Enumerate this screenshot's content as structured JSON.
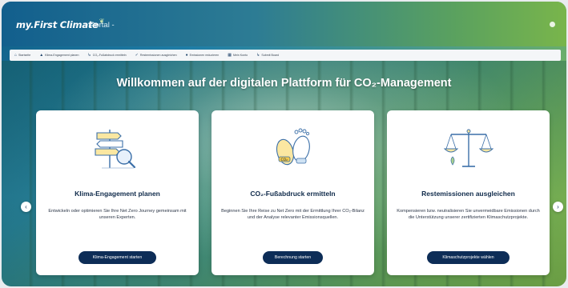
{
  "header": {
    "logo_text": "my.First Climate",
    "portal_label": "Portal -"
  },
  "nav": {
    "items": [
      {
        "icon": "home-icon",
        "glyph": "⌂",
        "label": "Startseite"
      },
      {
        "icon": "signpost-icon",
        "glyph": "▲",
        "label": "Klima-Engagement planen"
      },
      {
        "icon": "footprint-icon",
        "glyph": "↳",
        "label": "CO₂-Fußabdruck ermitteln"
      },
      {
        "icon": "check-icon",
        "glyph": "✓",
        "label": "Restemissionen ausgleichen"
      },
      {
        "icon": "search-icon",
        "glyph": "●",
        "label": "Emissionen reduzieren"
      },
      {
        "icon": "grid-icon",
        "glyph": "▦",
        "label": "Mein Konto"
      },
      {
        "icon": "chart-icon",
        "glyph": "↳",
        "label": "Submit Board"
      }
    ]
  },
  "hero": {
    "headline": "Willkommen auf der digitalen Plattform für CO₂-Management"
  },
  "cards": [
    {
      "title": "Klima-Engagement planen",
      "text": "Entwickeln oder optimieren Sie Ihre Net Zero Journey gemeinsam mit unseren Experten.",
      "button": "Klima-Engagement starten",
      "illustration": "signpost-magnifier-icon"
    },
    {
      "title": "CO₂-Fußabdruck ermitteln",
      "text": "Beginnen Sie Ihre Reise zu Net Zero mit der Ermittlung Ihrer CO₂-Bilanz und der Analyse relevanter Emissionsquellen.",
      "button": "Berechnung starten",
      "illustration": "footprint-icon"
    },
    {
      "title": "Restemissionen ausgleichen",
      "text": "Kompensieren bzw. neutralisieren Sie unvermeidbare Emissionen durch die Unterstützung unserer zertifizierten Klimaschutzprojekte.",
      "button": "Klimaschutzprojekte wählen",
      "illustration": "scales-icon"
    }
  ],
  "carousel": {
    "prev_glyph": "‹",
    "next_glyph": "›"
  },
  "colors": {
    "header_start": "#125f8d",
    "header_end": "#79b54b",
    "button": "#0d2d57",
    "icon_accent": "#f2c94c",
    "icon_line": "#3b6fa8"
  }
}
